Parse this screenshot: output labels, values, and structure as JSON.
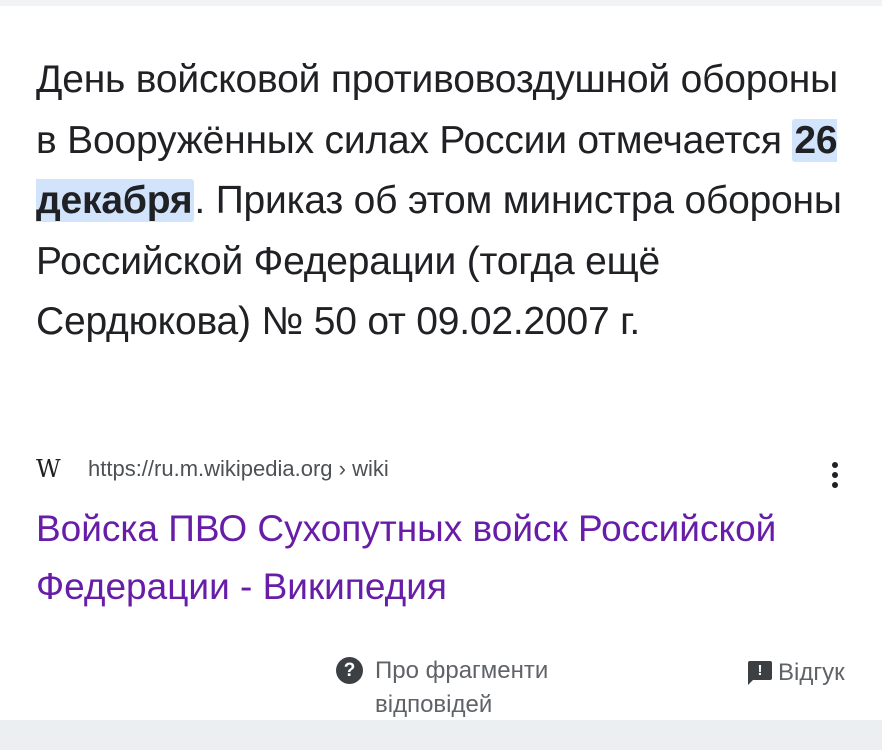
{
  "snippet": {
    "before": "День войсковой противовоздушной обороны в Вооружённых силах России отмечается ",
    "highlight": "26 декабря",
    "after": ". Приказ об этом министра обороны Российской Федерации (тогда ещё Сердюкова) № 50 от 09.02.2007 г."
  },
  "source": {
    "icon_glyph": "W",
    "url": "https://ru.m.wikipedia.org › wiki"
  },
  "result": {
    "title": "Войска ПВО Сухопутных войск Российской Федерации - Википедия"
  },
  "footer": {
    "help_glyph": "?",
    "about_label": "Про фрагменти відповідей",
    "feedback_glyph": "!",
    "feedback_label": "Відгук"
  },
  "colors": {
    "highlight_bg": "#d2e3fc",
    "visited_link": "#681da8",
    "text": "#202124",
    "secondary_text": "#5f6368"
  },
  "icons": {
    "source": "wikipedia-icon",
    "menu": "more-vert-icon",
    "help": "help-circle-icon",
    "feedback": "feedback-flag-icon"
  }
}
